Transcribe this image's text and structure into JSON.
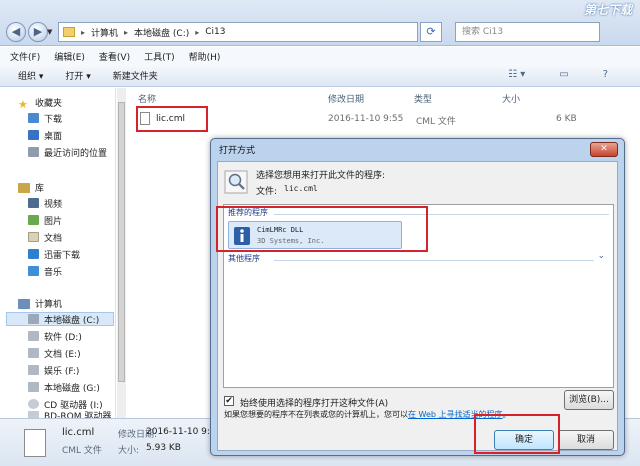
{
  "explorer": {
    "breadcrumb": [
      "计算机",
      "本地磁盘 (C:)",
      "Ci13"
    ],
    "search_placeholder": "搜索 Ci13",
    "watermark": "第七下载",
    "menu": [
      "文件(F)",
      "编辑(E)",
      "查看(V)",
      "工具(T)",
      "帮助(H)"
    ],
    "toolbar": [
      "组织 ▾",
      "打开 ▾",
      "新建文件夹"
    ],
    "sidebar": {
      "favorites": {
        "title": "收藏夹",
        "items": [
          "下载",
          "桌面",
          "最近访问的位置"
        ]
      },
      "libraries": {
        "title": "库",
        "items": [
          "视频",
          "图片",
          "文档",
          "迅雷下载",
          "音乐"
        ]
      },
      "computer": {
        "title": "计算机",
        "items": [
          "本地磁盘 (C:)",
          "软件 (D:)",
          "文档 (E:)",
          "娱乐 (F:)",
          "本地磁盘 (G:)",
          "CD 驱动器 (I:)",
          "BD-ROM 驱动器"
        ]
      }
    },
    "columns": {
      "name": "名称",
      "modified": "修改日期",
      "type": "类型",
      "size": "大小"
    },
    "files": [
      {
        "name": "lic.cml",
        "modified": "2016-11-10 9:55",
        "type": "CML 文件",
        "size": "6 KB"
      }
    ],
    "status": {
      "name": "lic.cml",
      "modified_label": "修改日期:",
      "modified": "2016-11-10 9:5",
      "type": "CML 文件",
      "size_label": "大小:",
      "size": "5.93 KB"
    }
  },
  "dialog": {
    "title": "打开方式",
    "close": "✕",
    "prompt": "选择您想用来打开此文件的程序:",
    "file_label": "文件:",
    "file_name": "lic.cml",
    "recommended_label": "推荐的程序",
    "program": {
      "name": "CimLMRc DLL",
      "vendor": "3D Systems, Inc."
    },
    "other_label": "其他程序",
    "always_use": "始终使用选择的程序打开这种文件(A)",
    "browse": "浏览(B)...",
    "hint_prefix": "如果您想要的程序不在列表或您的计算机上，您可以",
    "hint_link": "在 Web 上寻找适当的程序",
    "hint_suffix": "。",
    "ok": "确定",
    "cancel": "取消"
  }
}
